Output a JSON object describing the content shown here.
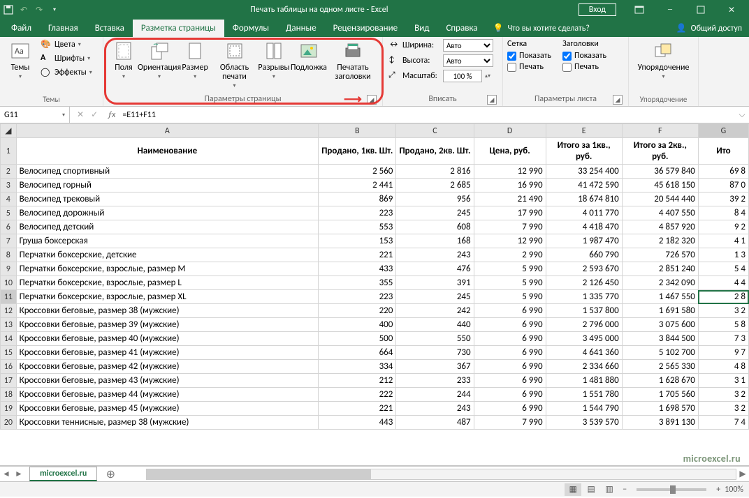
{
  "titlebar": {
    "title": "Печать таблицы на одном листе - Excel",
    "login": "Вход"
  },
  "tabs": [
    "Файл",
    "Главная",
    "Вставка",
    "Разметка страницы",
    "Формулы",
    "Данные",
    "Рецензирование",
    "Вид",
    "Справка"
  ],
  "active_tab": 3,
  "tell_me": "Что вы хотите сделать?",
  "share": "Общий доступ",
  "ribbon": {
    "themes": {
      "label": "Темы",
      "colors": "Цвета",
      "fonts": "Шрифты",
      "effects": "Эффекты",
      "btn": "Темы"
    },
    "page_setup": {
      "label": "Параметры страницы",
      "margins": "Поля",
      "orientation": "Ориентация",
      "size": "Размер",
      "print_area": "Область печати",
      "breaks": "Разрывы",
      "background": "Подложка",
      "print_titles": "Печатать заголовки"
    },
    "fit": {
      "label": "Вписать",
      "width": "Ширина:",
      "height": "Высота:",
      "scale": "Масштаб:",
      "auto": "Авто",
      "scale_val": "100 %"
    },
    "sheet_opts": {
      "label": "Параметры листа",
      "grid": "Сетка",
      "headings": "Заголовки",
      "show": "Показать",
      "print": "Печать"
    },
    "arrange": {
      "label": "Упорядочение",
      "btn": "Упорядочение"
    }
  },
  "namebox": "G11",
  "formula": "=E11+F11",
  "columns": [
    "A",
    "B",
    "C",
    "D",
    "E",
    "F",
    "G"
  ],
  "headers": [
    "Наименование",
    "Продано, 1кв. Шт.",
    "Продано, 2кв. Шт.",
    "Цена, руб.",
    "Итого за 1кв., руб.",
    "Итого за 2кв., руб.",
    "Ито"
  ],
  "rows": [
    {
      "n": 2,
      "a": "Велосипед спортивный",
      "b": "2 560",
      "c": "2 816",
      "d": "12 990",
      "e": "33 254 400",
      "f": "36 579 840",
      "g": "69 8"
    },
    {
      "n": 3,
      "a": "Велосипед горный",
      "b": "2 441",
      "c": "2 685",
      "d": "16 990",
      "e": "41 472 590",
      "f": "45 618 150",
      "g": "87 0"
    },
    {
      "n": 4,
      "a": "Велосипед трековый",
      "b": "869",
      "c": "956",
      "d": "21 490",
      "e": "18 674 810",
      "f": "20 544 440",
      "g": "39 2"
    },
    {
      "n": 5,
      "a": "Велосипед дорожный",
      "b": "223",
      "c": "245",
      "d": "17 990",
      "e": "4 011 770",
      "f": "4 407 550",
      "g": "8 4"
    },
    {
      "n": 6,
      "a": "Велосипед детский",
      "b": "553",
      "c": "608",
      "d": "7 990",
      "e": "4 418 470",
      "f": "4 857 920",
      "g": "9 2"
    },
    {
      "n": 7,
      "a": "Груша боксерская",
      "b": "153",
      "c": "168",
      "d": "12 990",
      "e": "1 987 470",
      "f": "2 182 320",
      "g": "4 1"
    },
    {
      "n": 8,
      "a": "Перчатки боксерские, детские",
      "b": "221",
      "c": "243",
      "d": "2 990",
      "e": "660 790",
      "f": "726 570",
      "g": "1 3"
    },
    {
      "n": 9,
      "a": "Перчатки боксерские, взрослые, размер M",
      "b": "433",
      "c": "476",
      "d": "5 990",
      "e": "2 593 670",
      "f": "2 851 240",
      "g": "5 4"
    },
    {
      "n": 10,
      "a": "Перчатки боксерские, взрослые, размер L",
      "b": "355",
      "c": "391",
      "d": "5 990",
      "e": "2 126 450",
      "f": "2 342 090",
      "g": "4 4"
    },
    {
      "n": 11,
      "a": "Перчатки боксерские, взрослые, размер XL",
      "b": "223",
      "c": "245",
      "d": "5 990",
      "e": "1 335 770",
      "f": "1 467 550",
      "g": "2 8"
    },
    {
      "n": 12,
      "a": "Кроссовки беговые, размер 38 (мужские)",
      "b": "220",
      "c": "242",
      "d": "6 990",
      "e": "1 537 800",
      "f": "1 691 580",
      "g": "3 2"
    },
    {
      "n": 13,
      "a": "Кроссовки беговые, размер 39 (мужские)",
      "b": "400",
      "c": "440",
      "d": "6 990",
      "e": "2 796 000",
      "f": "3 075 600",
      "g": "5 8"
    },
    {
      "n": 14,
      "a": "Кроссовки беговые, размер 40 (мужские)",
      "b": "500",
      "c": "550",
      "d": "6 990",
      "e": "3 495 000",
      "f": "3 844 500",
      "g": "7 3"
    },
    {
      "n": 15,
      "a": "Кроссовки беговые, размер 41 (мужские)",
      "b": "664",
      "c": "730",
      "d": "6 990",
      "e": "4 641 360",
      "f": "5 102 700",
      "g": "9 7"
    },
    {
      "n": 16,
      "a": "Кроссовки беговые, размер 42 (мужские)",
      "b": "334",
      "c": "367",
      "d": "6 990",
      "e": "2 334 660",
      "f": "2 565 330",
      "g": "4 8"
    },
    {
      "n": 17,
      "a": "Кроссовки беговые, размер 43 (мужские)",
      "b": "212",
      "c": "233",
      "d": "6 990",
      "e": "1 481 880",
      "f": "1 628 670",
      "g": "3 1"
    },
    {
      "n": 18,
      "a": "Кроссовки беговые, размер 44 (мужские)",
      "b": "222",
      "c": "244",
      "d": "6 990",
      "e": "1 551 780",
      "f": "1 705 560",
      "g": "3 2"
    },
    {
      "n": 19,
      "a": "Кроссовки беговые, размер 45 (мужские)",
      "b": "221",
      "c": "243",
      "d": "6 990",
      "e": "1 544 790",
      "f": "1 698 570",
      "g": "3 2"
    },
    {
      "n": 20,
      "a": "Кроссовки теннисные, размер 38 (мужские)",
      "b": "443",
      "c": "487",
      "d": "7 990",
      "e": "3 539 570",
      "f": "3 891 130",
      "g": "7 4"
    }
  ],
  "sheet_tab": "microexcel.ru",
  "zoom": "100%",
  "watermark": "microexcel.ru"
}
